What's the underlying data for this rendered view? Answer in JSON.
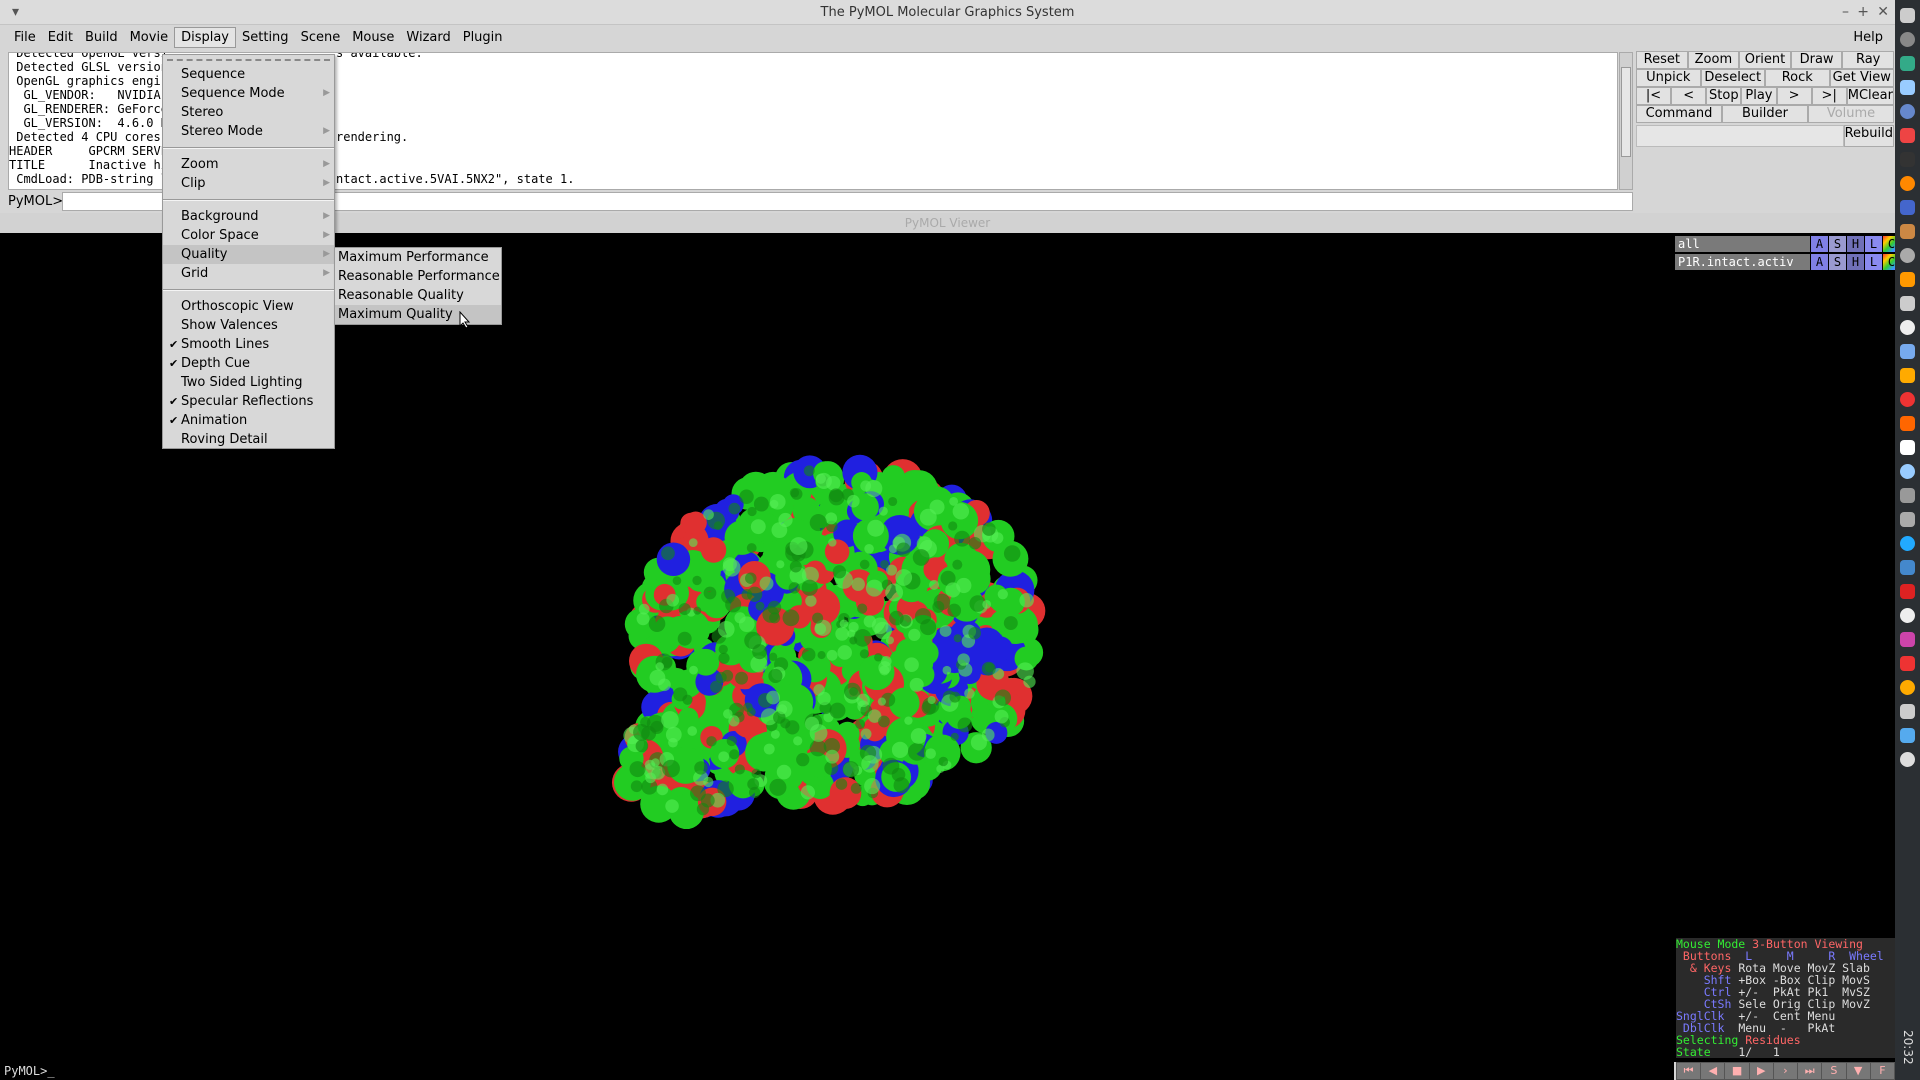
{
  "window": {
    "title": "The PyMOL Molecular Graphics System"
  },
  "menubar": [
    "File",
    "Edit",
    "Build",
    "Movie",
    "Display",
    "Setting",
    "Scene",
    "Mouse",
    "Wizard",
    "Plugin"
  ],
  "help": "Help",
  "output": [
    {
      "left": " Detected OpenGL versi",
      "right": "s available."
    },
    {
      "left": " Detected GLSL version",
      "right": ""
    },
    {
      "left": " OpenGL graphics engi",
      "right": ""
    },
    {
      "left": "  GL_VENDOR:   NVIDIA",
      "right": ""
    },
    {
      "left": "  GL_RENDERER: GeForce",
      "right": ""
    },
    {
      "left": "  GL_VERSION:  4.6.0 N",
      "right": ""
    },
    {
      "left": " Detected 4 CPU cores.",
      "right": "rendering."
    },
    {
      "left": "HEADER     GPCRM SERVE",
      "right": ""
    },
    {
      "left": "TITLE      Inactive hi",
      "right": ""
    },
    {
      "left": " CmdLoad: PDB-string l",
      "right": "ntact.active.5VAI.5NX2\", state 1."
    }
  ],
  "command": {
    "prompt": "PyMOL>"
  },
  "buttons": [
    [
      "Reset",
      "Zoom",
      "Orient",
      "Draw",
      "Ray"
    ],
    [
      "Unpick",
      "Deselect",
      "Rock",
      "Get View"
    ],
    [
      "|<",
      "<",
      "Stop",
      "Play",
      ">",
      ">|",
      "MClear"
    ],
    [
      "Command",
      "Builder",
      "Volume"
    ]
  ],
  "rebuild": "Rebuild",
  "viewer": {
    "title": "PyMOL Viewer",
    "bottom_prompt": "PyMOL>_"
  },
  "objects": [
    {
      "name": "all",
      "buttons": [
        "A",
        "S",
        "H",
        "L",
        "C"
      ]
    },
    {
      "name": "P1R.intact.activ",
      "buttons": [
        "A",
        "S",
        "H",
        "L",
        "C"
      ]
    }
  ],
  "display_menu": {
    "items": [
      {
        "label": "Sequence"
      },
      {
        "label": "Sequence Mode",
        "sub": true
      },
      {
        "label": "Stereo"
      },
      {
        "label": "Stereo Mode",
        "sub": true
      },
      {
        "sep": true
      },
      {
        "label": "Zoom",
        "sub": true
      },
      {
        "label": "Clip",
        "sub": true
      },
      {
        "sep": true
      },
      {
        "label": "Background",
        "sub": true
      },
      {
        "label": "Color Space",
        "sub": true
      },
      {
        "label": "Quality",
        "sub": true,
        "highlight": true
      },
      {
        "label": "Grid",
        "sub": true
      },
      {
        "sep": true
      },
      {
        "label": "Orthoscopic View"
      },
      {
        "label": "Show Valences"
      },
      {
        "label": "Smooth Lines",
        "checked": true
      },
      {
        "label": "Depth Cue",
        "checked": true
      },
      {
        "label": "Two Sided Lighting"
      },
      {
        "label": "Specular Reflections",
        "checked": true
      },
      {
        "label": "Animation",
        "checked": true
      },
      {
        "label": "Roving Detail"
      }
    ]
  },
  "quality_menu": [
    "Maximum Performance",
    "Reasonable Performance",
    "Reasonable Quality",
    "Maximum Quality"
  ],
  "quality_highlight": "Maximum Quality",
  "mouse_panel": [
    [
      [
        "g",
        "Mouse Mode "
      ],
      [
        "rd",
        "3-Button Viewing"
      ]
    ],
    [
      [
        "rd",
        " Buttons"
      ],
      [
        "b",
        "  L     M     R  Wheel"
      ]
    ],
    [
      [
        "rd",
        "  & Keys"
      ],
      [
        "w",
        " Rota Move MovZ Slab"
      ]
    ],
    [
      [
        "b",
        "    Shft"
      ],
      [
        "w",
        " +Box -Box Clip MovS"
      ]
    ],
    [
      [
        "b",
        "    Ctrl"
      ],
      [
        "w",
        " +/-  PkAt Pk1  MvSZ"
      ]
    ],
    [
      [
        "b",
        "    CtSh"
      ],
      [
        "w",
        " Sele Orig Clip MovZ"
      ]
    ],
    [
      [
        "b",
        "SnglClk"
      ],
      [
        "w",
        "  +/-  Cent Menu"
      ]
    ],
    [
      [
        "b",
        " DblClk"
      ],
      [
        "w",
        "  Menu  -   PkAt"
      ]
    ],
    [
      [
        "g",
        "Selecting "
      ],
      [
        "rd",
        "Residues"
      ]
    ],
    [
      [
        "g",
        "State"
      ],
      [
        "w",
        "    1/   1"
      ]
    ]
  ],
  "movie_controls": [
    "⏮",
    "◀",
    "■",
    "▶",
    "›",
    "⏭",
    "S",
    "▼",
    "F"
  ],
  "clock": "20:32",
  "colors": {
    "surface_carbon": "#22cc22",
    "surface_oxygen": "#e03030",
    "surface_nitrogen": "#2020e0"
  }
}
